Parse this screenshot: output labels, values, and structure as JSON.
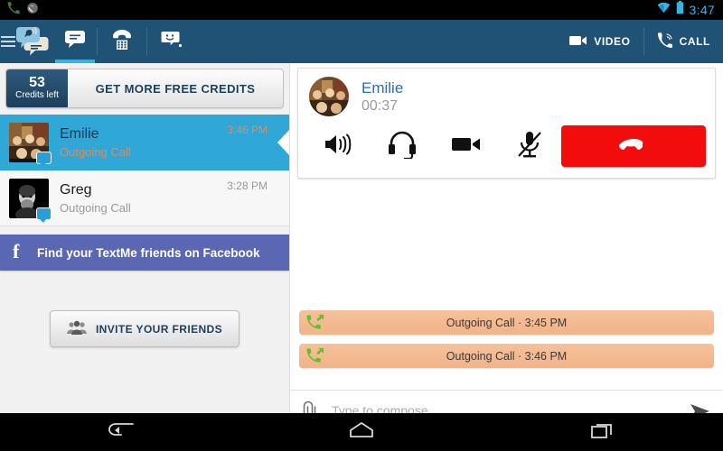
{
  "statusbar": {
    "time": "3:47",
    "icons": [
      "phone-icon",
      "app-notification-icon",
      "wifi-icon",
      "battery-icon"
    ]
  },
  "actionbar": {
    "menu": "drawer-menu-icon",
    "logo": "textme-logo-icon",
    "tabs": [
      {
        "name": "messages",
        "icon": "chat-bubble-icon",
        "active": true
      },
      {
        "name": "dialer",
        "icon": "dialpad-phone-icon",
        "active": false
      },
      {
        "name": "stickers",
        "icon": "smiley-sticker-icon",
        "active": false
      }
    ],
    "video_label": "VIDEO",
    "call_label": "CALL"
  },
  "sidebar": {
    "credits": {
      "count": "53",
      "label": "Credits left",
      "cta": "GET MORE FREE CREDITS"
    },
    "conversations": [
      {
        "name": "Emilie",
        "subtitle": "Outgoing Call",
        "time": "3:46 PM",
        "selected": true
      },
      {
        "name": "Greg",
        "subtitle": "Outgoing Call",
        "time": "3:28 PM",
        "selected": false
      }
    ],
    "facebook_banner": "Find your TextMe friends on Facebook",
    "invite_label": "INVITE YOUR FRIENDS"
  },
  "call": {
    "contact": "Emilie",
    "duration": "00:37",
    "controls": [
      "speaker-icon",
      "headset-icon",
      "video-camera-icon",
      "mic-muted-icon"
    ],
    "hangup": "hangup-icon"
  },
  "chat": {
    "log": [
      {
        "icon": "outgoing-call-icon",
        "text": "Outgoing Call · 3:45 PM"
      },
      {
        "icon": "outgoing-call-icon",
        "text": "Outgoing Call · 3:46 PM"
      }
    ],
    "compose_placeholder": "Type to compose",
    "compose_value": "",
    "attach": "paperclip-icon",
    "send": "send-icon"
  },
  "navbar": {
    "back": "back-icon",
    "home": "home-icon",
    "recents": "recents-icon"
  },
  "colors": {
    "actionbar": "#1f5274",
    "accent": "#34b3e4",
    "selected_row": "#2fa8d8",
    "facebook": "#5a68b4",
    "hangup": "#f20c0c",
    "log_bubble": "#f4b78e",
    "status_icon": "#31b6e7"
  }
}
